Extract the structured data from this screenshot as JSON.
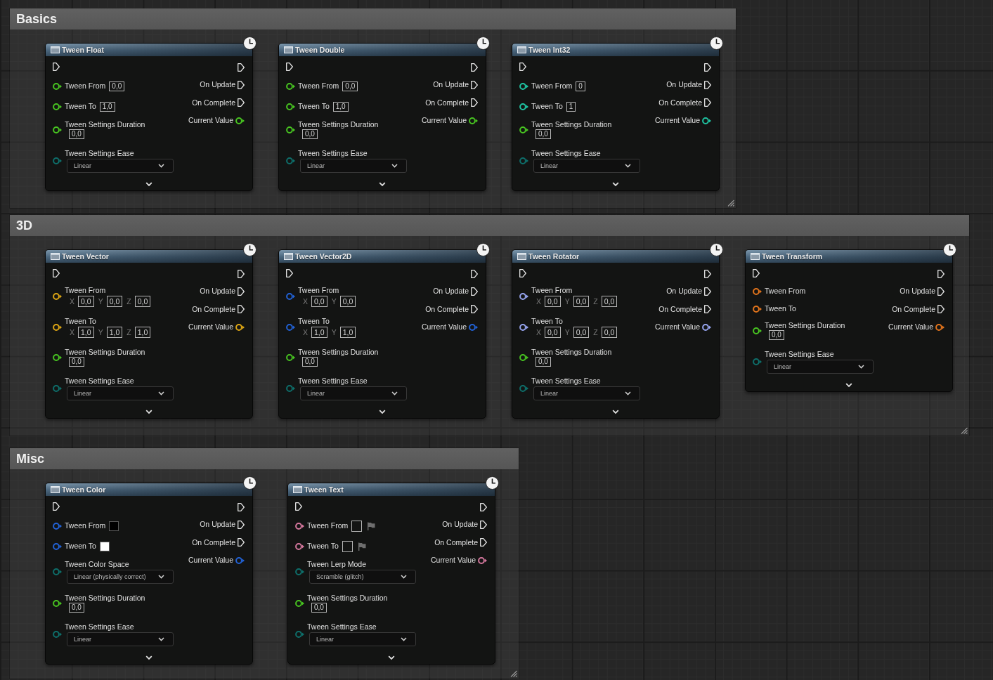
{
  "comments": [
    {
      "title": "Basics",
      "nodes": [
        {
          "title": "Tween Float",
          "inputs": [
            {
              "kind": "exec"
            },
            {
              "kind": "number",
              "label": "Tween From",
              "color": "#48c421",
              "value": "0,0"
            },
            {
              "kind": "number",
              "label": "Tween To",
              "color": "#48c421",
              "value": "1,0"
            },
            {
              "kind": "number_below",
              "label": "Tween Settings Duration",
              "color": "#48c421",
              "value": "0,0"
            },
            {
              "kind": "enum",
              "label": "Tween Settings Ease",
              "color": "#0e6f6b",
              "value": "Linear"
            }
          ],
          "outputs": [
            {
              "kind": "exec"
            },
            {
              "kind": "exec",
              "label": "On Update"
            },
            {
              "kind": "exec",
              "label": "On Complete"
            },
            {
              "kind": "data",
              "label": "Current Value",
              "color": "#48c421"
            }
          ]
        },
        {
          "title": "Tween Double",
          "inputs": [
            {
              "kind": "exec"
            },
            {
              "kind": "number",
              "label": "Tween From",
              "color": "#48c421",
              "value": "0,0"
            },
            {
              "kind": "number",
              "label": "Tween To",
              "color": "#48c421",
              "value": "1,0"
            },
            {
              "kind": "number_below",
              "label": "Tween Settings Duration",
              "color": "#48c421",
              "value": "0,0"
            },
            {
              "kind": "enum",
              "label": "Tween Settings Ease",
              "color": "#0e6f6b",
              "value": "Linear"
            }
          ],
          "outputs": [
            {
              "kind": "exec"
            },
            {
              "kind": "exec",
              "label": "On Update"
            },
            {
              "kind": "exec",
              "label": "On Complete"
            },
            {
              "kind": "data",
              "label": "Current Value",
              "color": "#48c421"
            }
          ]
        },
        {
          "title": "Tween Int32",
          "inputs": [
            {
              "kind": "exec"
            },
            {
              "kind": "number",
              "label": "Tween From",
              "color": "#1fc4a2",
              "value": "0"
            },
            {
              "kind": "number",
              "label": "Tween To",
              "color": "#1fc4a2",
              "value": "1"
            },
            {
              "kind": "number_below",
              "label": "Tween Settings Duration",
              "color": "#48c421",
              "value": "0,0"
            },
            {
              "kind": "enum",
              "label": "Tween Settings Ease",
              "color": "#0e6f6b",
              "value": "Linear"
            }
          ],
          "outputs": [
            {
              "kind": "exec"
            },
            {
              "kind": "exec",
              "label": "On Update"
            },
            {
              "kind": "exec",
              "label": "On Complete"
            },
            {
              "kind": "data",
              "label": "Current Value",
              "color": "#1fc4a2"
            }
          ]
        }
      ]
    },
    {
      "title": "3D",
      "nodes": [
        {
          "title": "Tween Vector",
          "inputs": [
            {
              "kind": "exec"
            },
            {
              "kind": "vector",
              "label": "Tween From",
              "color": "#dca514",
              "components": [
                {
                  "axis": "X",
                  "value": "0,0"
                },
                {
                  "axis": "Y",
                  "value": "0,0"
                },
                {
                  "axis": "Z",
                  "value": "0,0"
                }
              ]
            },
            {
              "kind": "vector",
              "label": "Tween To",
              "color": "#dca514",
              "components": [
                {
                  "axis": "X",
                  "value": "1,0"
                },
                {
                  "axis": "Y",
                  "value": "1,0"
                },
                {
                  "axis": "Z",
                  "value": "1,0"
                }
              ]
            },
            {
              "kind": "number_below",
              "label": "Tween Settings Duration",
              "color": "#48c421",
              "value": "0,0"
            },
            {
              "kind": "enum",
              "label": "Tween Settings Ease",
              "color": "#0e6f6b",
              "value": "Linear"
            }
          ],
          "outputs": [
            {
              "kind": "exec"
            },
            {
              "kind": "exec",
              "label": "On Update"
            },
            {
              "kind": "exec",
              "label": "On Complete"
            },
            {
              "kind": "data",
              "label": "Current Value",
              "color": "#dca514"
            }
          ]
        },
        {
          "title": "Tween Vector2D",
          "inputs": [
            {
              "kind": "exec"
            },
            {
              "kind": "vector",
              "label": "Tween From",
              "color": "#2262d6",
              "components": [
                {
                  "axis": "X",
                  "value": "0,0"
                },
                {
                  "axis": "Y",
                  "value": "0,0"
                }
              ]
            },
            {
              "kind": "vector",
              "label": "Tween To",
              "color": "#2262d6",
              "components": [
                {
                  "axis": "X",
                  "value": "1,0"
                },
                {
                  "axis": "Y",
                  "value": "1,0"
                }
              ]
            },
            {
              "kind": "number_below",
              "label": "Tween Settings Duration",
              "color": "#48c421",
              "value": "0,0"
            },
            {
              "kind": "enum",
              "label": "Tween Settings Ease",
              "color": "#0e6f6b",
              "value": "Linear"
            }
          ],
          "outputs": [
            {
              "kind": "exec"
            },
            {
              "kind": "exec",
              "label": "On Update"
            },
            {
              "kind": "exec",
              "label": "On Complete"
            },
            {
              "kind": "data",
              "label": "Current Value",
              "color": "#2262d6"
            }
          ]
        },
        {
          "title": "Tween Rotator",
          "inputs": [
            {
              "kind": "exec"
            },
            {
              "kind": "vector",
              "label": "Tween From",
              "color": "#97a5f0",
              "components": [
                {
                  "axis": "X",
                  "value": "0,0"
                },
                {
                  "axis": "Y",
                  "value": "0,0"
                },
                {
                  "axis": "Z",
                  "value": "0,0"
                }
              ]
            },
            {
              "kind": "vector",
              "label": "Tween To",
              "color": "#97a5f0",
              "components": [
                {
                  "axis": "X",
                  "value": "0,0"
                },
                {
                  "axis": "Y",
                  "value": "0,0"
                },
                {
                  "axis": "Z",
                  "value": "0,0"
                }
              ]
            },
            {
              "kind": "number_below",
              "label": "Tween Settings Duration",
              "color": "#48c421",
              "value": "0,0"
            },
            {
              "kind": "enum",
              "label": "Tween Settings Ease",
              "color": "#0e6f6b",
              "value": "Linear"
            }
          ],
          "outputs": [
            {
              "kind": "exec"
            },
            {
              "kind": "exec",
              "label": "On Update"
            },
            {
              "kind": "exec",
              "label": "On Complete"
            },
            {
              "kind": "data",
              "label": "Current Value",
              "color": "#97a5f0"
            }
          ]
        },
        {
          "title": "Tween Transform",
          "inputs": [
            {
              "kind": "exec"
            },
            {
              "kind": "struct",
              "label": "Tween From",
              "color": "#e2741c"
            },
            {
              "kind": "struct",
              "label": "Tween To",
              "color": "#e2741c"
            },
            {
              "kind": "number_below",
              "label": "Tween Settings Duration",
              "color": "#48c421",
              "value": "0,0"
            },
            {
              "kind": "enum",
              "label": "Tween Settings Ease",
              "color": "#0e6f6b",
              "value": "Linear"
            }
          ],
          "outputs": [
            {
              "kind": "exec"
            },
            {
              "kind": "exec",
              "label": "On Update"
            },
            {
              "kind": "exec",
              "label": "On Complete"
            },
            {
              "kind": "data",
              "label": "Current Value",
              "color": "#e2741c"
            }
          ]
        }
      ]
    },
    {
      "title": "Misc",
      "nodes": [
        {
          "title": "Tween Color",
          "inputs": [
            {
              "kind": "exec"
            },
            {
              "kind": "color",
              "label": "Tween From",
              "color": "#2262d6",
              "swatch": {
                "color": "#000000"
              }
            },
            {
              "kind": "color",
              "label": "Tween To",
              "color": "#2262d6",
              "swatch": {
                "color": "#ffffff"
              }
            },
            {
              "kind": "enum",
              "label": "Tween Color Space",
              "color": "#0e6f6b",
              "value": "Linear (physically correct)"
            },
            {
              "kind": "number_below",
              "label": "Tween Settings Duration",
              "color": "#48c421",
              "value": "0,0"
            },
            {
              "kind": "enum",
              "label": "Tween Settings Ease",
              "color": "#0e6f6b",
              "value": "Linear"
            }
          ],
          "outputs": [
            {
              "kind": "exec"
            },
            {
              "kind": "exec",
              "label": "On Update"
            },
            {
              "kind": "exec",
              "label": "On Complete"
            },
            {
              "kind": "data",
              "label": "Current Value",
              "color": "#2262d6"
            }
          ]
        },
        {
          "title": "Tween Text",
          "inputs": [
            {
              "kind": "exec"
            },
            {
              "kind": "text",
              "label": "Tween From",
              "color": "#d5789e"
            },
            {
              "kind": "text",
              "label": "Tween To",
              "color": "#d5789e"
            },
            {
              "kind": "enum",
              "label": "Tween Lerp Mode",
              "color": "#0e6f6b",
              "value": "Scramble (glitch)"
            },
            {
              "kind": "number_below",
              "label": "Tween Settings Duration",
              "color": "#48c421",
              "value": "0,0"
            },
            {
              "kind": "enum",
              "label": "Tween Settings Ease",
              "color": "#0e6f6b",
              "value": "Linear"
            }
          ],
          "outputs": [
            {
              "kind": "exec"
            },
            {
              "kind": "exec",
              "label": "On Update"
            },
            {
              "kind": "exec",
              "label": "On Complete"
            },
            {
              "kind": "data",
              "label": "Current Value",
              "color": "#d5789e"
            }
          ]
        }
      ]
    }
  ]
}
